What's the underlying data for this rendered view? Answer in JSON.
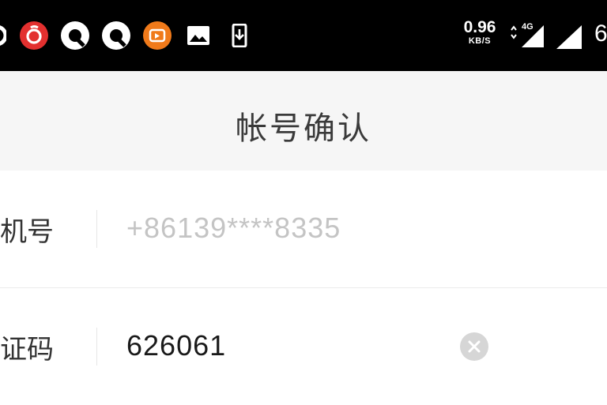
{
  "status_bar": {
    "notification_icons": [
      {
        "name": "netease-music-icon",
        "color": "#e3302f"
      },
      {
        "name": "qq-icon",
        "color": "#ffffff"
      },
      {
        "name": "qq-icon",
        "color": "#ffffff"
      },
      {
        "name": "weibo-video-icon",
        "color": "#f07a1a"
      },
      {
        "name": "image-icon",
        "color": "#ffffff"
      },
      {
        "name": "download-icon",
        "color": "#ffffff"
      }
    ],
    "net_speed_value": "0.96",
    "net_speed_unit": "KB/S",
    "network_type": "4G",
    "battery_partial": "6"
  },
  "header": {
    "title": "帐号确认"
  },
  "form": {
    "phone_label": "机号",
    "phone_placeholder": "+86139****8335",
    "code_label": "证码",
    "code_value": "626061"
  },
  "colors": {
    "status_bar_bg": "#000000",
    "header_bg": "#f6f6f6",
    "placeholder_text": "#c4c4c4",
    "clear_icon": "#d6d6d6"
  }
}
